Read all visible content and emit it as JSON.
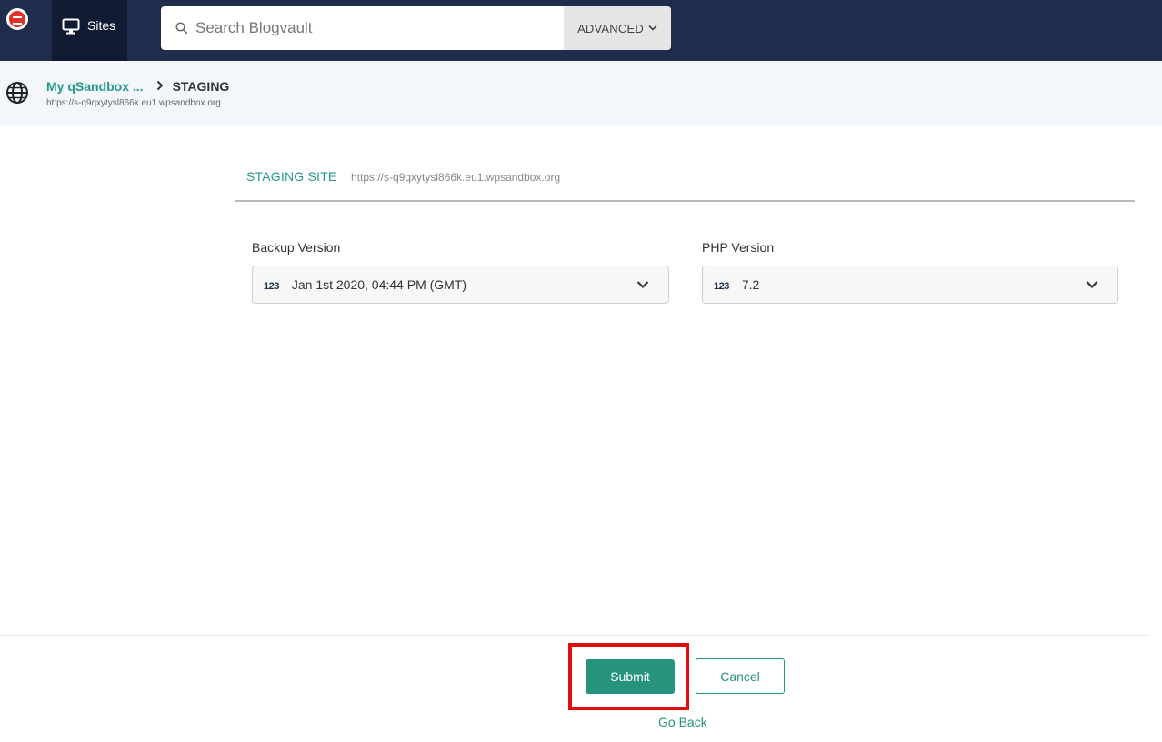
{
  "topbar": {
    "sites_label": "Sites",
    "search_placeholder": "Search Blogvault",
    "advanced_label": "ADVANCED"
  },
  "breadcrumb": {
    "site_name": "My qSandbox ...",
    "current": "STAGING",
    "site_url": "https://s-q9qxytysl866k.eu1.wpsandbox.org"
  },
  "staging": {
    "title": "STAGING SITE",
    "url": "https://s-q9qxytysl866k.eu1.wpsandbox.org"
  },
  "form": {
    "backup_label": "Backup Version",
    "backup_value": "Jan 1st 2020, 04:44 PM (GMT)",
    "php_label": "PHP Version",
    "php_value": "7.2",
    "number_icon_text": "123"
  },
  "actions": {
    "submit_label": "Submit",
    "cancel_label": "Cancel",
    "goback_label": "Go Back"
  },
  "colors": {
    "nav_bg": "#1f2d4d",
    "accent": "#26937f",
    "highlight": "#e10d0d"
  }
}
